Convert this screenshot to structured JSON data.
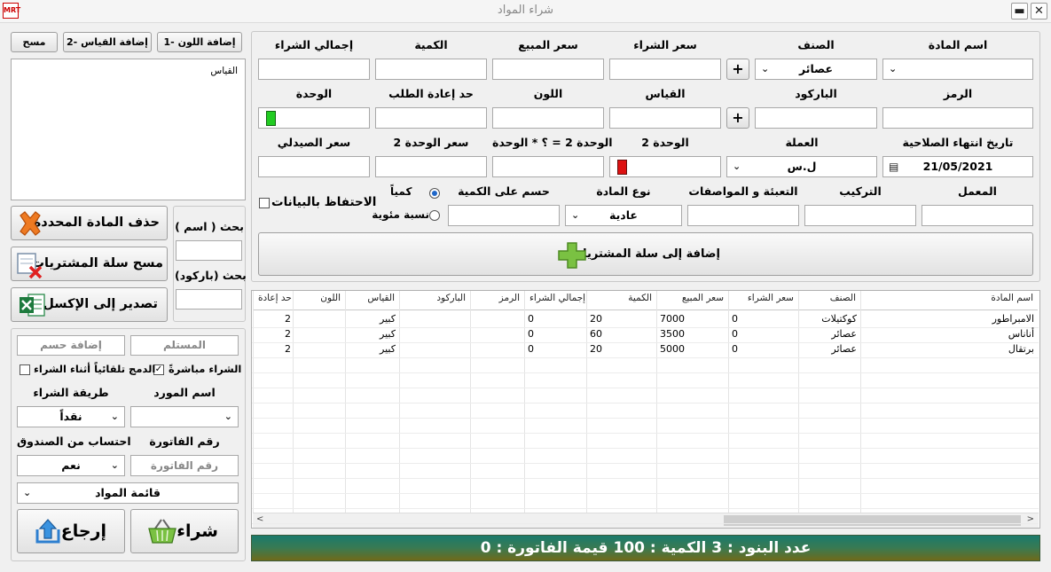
{
  "window": {
    "title": "شراء المواد",
    "icon_text": "MRT",
    "minimize": "▬",
    "close": "✕"
  },
  "form": {
    "row1": {
      "labels": [
        "اسم المادة",
        "الصنف",
        "سعر الشراء",
        "سعر المبيع",
        "الكمية",
        "إجمالي الشراء"
      ],
      "category_value": "عصائر",
      "add_btn": "+"
    },
    "row2": {
      "labels": [
        "الرمز",
        "الباركود",
        "القياس",
        "اللون",
        "حد إعادة الطلب",
        "الوحدة"
      ],
      "add_btn": "+"
    },
    "row3": {
      "labels": [
        "تاريخ انتهاء الصلاحية",
        "العملة",
        "الوحدة 2",
        "الوحدة 2 = ؟ * الوحدة",
        "سعر الوحدة 2",
        "سعر الصيدلي"
      ],
      "date_value": "21/05/2021",
      "currency_value": "ل.س"
    },
    "row4": {
      "labels": [
        "المعمل",
        "التركيب",
        "التعبئة و المواصفات",
        "نوع المادة",
        "حسم على الكمية"
      ],
      "type_value": "عادية",
      "radio_qty": "كمياً",
      "radio_pct": "نسبة مئوية",
      "keep_data": "الاحتفاظ بالبيانات"
    },
    "add_to_cart": "إضافة إلى سلة المشتريات"
  },
  "left": {
    "btn_color": "1- إضافة اللون",
    "btn_size": "2- إضافة القياس",
    "btn_clear": "مسح",
    "list_header": "القياس",
    "delete_btn": "حذف المادة المحددة",
    "clear_cart_btn": "مسح سلة المشتريات",
    "export_btn": "تصدير إلى الإكسل",
    "search_name": "بحث ( اسم )",
    "search_barcode": "بحث (باركود)"
  },
  "purchase": {
    "receiver_ph": "المستلم",
    "discount_ph": "إضافة حسم",
    "direct_buy": "الشراء مباشرةً",
    "auto_merge": "الدمج تلقائياً أثناء الشراء",
    "supplier_label": "اسم المورد",
    "method_label": "طريقة الشراء",
    "method_value": "نقداً",
    "invoice_label": "رقم الفاتورة",
    "cashbox_label": "احتساب من الصندوق",
    "invoice_ph": "رقم الفاتورة",
    "cashbox_value": "نعم",
    "list_value": "قائمة المواد",
    "buy_btn": "شراء",
    "return_btn": "إرجاع"
  },
  "grid": {
    "headers": [
      "اسم المادة",
      "الصنف",
      "سعر الشراء",
      "سعر المبيع",
      "الكمية",
      "إجمالي الشراء",
      "الرمز",
      "الباركود",
      "القياس",
      "اللون",
      "حد إعادة"
    ],
    "rows": [
      [
        "الامبراطور",
        "كوكتيلات",
        "0",
        "7000",
        "20",
        "0",
        "",
        "",
        "كبير",
        "",
        "2"
      ],
      [
        "أناناس",
        "عصائر",
        "0",
        "3500",
        "60",
        "0",
        "",
        "",
        "كبير",
        "",
        "2"
      ],
      [
        "برتقال",
        "عصائر",
        "0",
        "5000",
        "20",
        "0",
        "",
        "",
        "كبير",
        "",
        "2"
      ]
    ]
  },
  "status": {
    "text": "عدد البنود : 3  الكمية : 100  قيمة الفاتورة : 0"
  }
}
